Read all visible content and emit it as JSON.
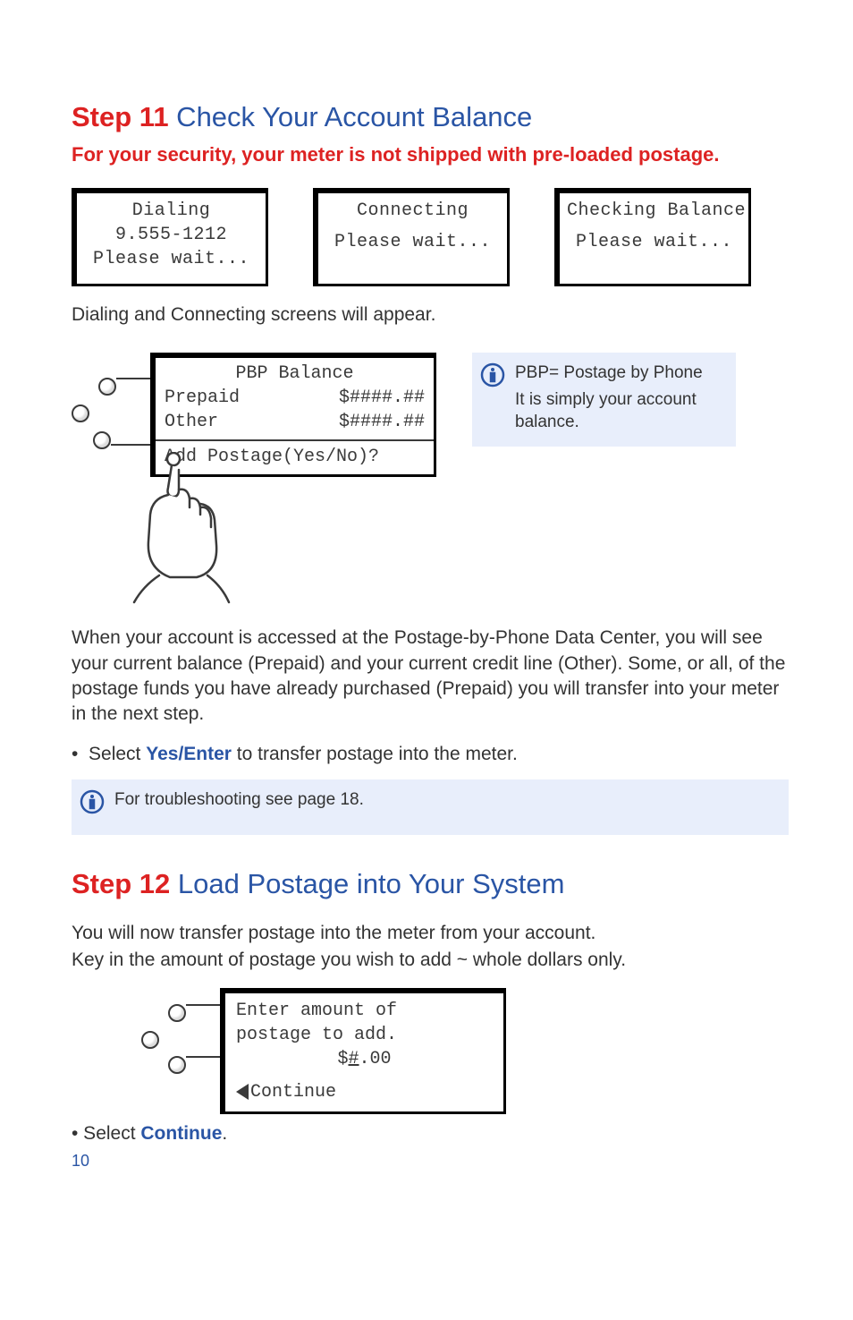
{
  "step11": {
    "num": "Step 11",
    "title": " Check Your Account Balance",
    "warning": "For your security, your meter is not shipped with pre-loaded postage.",
    "lcd1_l1": "Dialing",
    "lcd1_l2": "9.555-1212",
    "lcd1_l3": "Please wait...",
    "lcd2_l1": "Connecting",
    "lcd2_l2": "Please wait...",
    "lcd3_l1": "Checking Balance",
    "lcd3_l2": "Please wait...",
    "caption1": "Dialing and Connecting screens will appear.",
    "balance_title": "PBP Balance",
    "balance_prepaid_label": "Prepaid",
    "balance_prepaid_value": "$####.##",
    "balance_other_label": "Other",
    "balance_other_value": "$####.##",
    "balance_prompt": "Add Postage(Yes/No)?",
    "info1_line1": "PBP= Postage by Phone",
    "info1_line2": "It is simply your account balance.",
    "para1": "When your account is accessed at the Postage-by-Phone Data Center, you will see your current balance (Prepaid) and your current credit line (Other). Some, or all, of the postage funds you have already purchased (Prepaid) you will transfer into your meter in the next step.",
    "bullet1_pre": "Select ",
    "bullet1_kw": "Yes/Enter",
    "bullet1_post": " to transfer postage into the meter.",
    "info2": "For troubleshooting see page 18."
  },
  "step12": {
    "num": "Step 12",
    "title": " Load Postage into Your System",
    "para1": "You will now transfer postage into the meter from your account.",
    "para2": "Key in the amount of postage you wish to add ~ whole dollars only.",
    "lcd_l1": "Enter amount of",
    "lcd_l2": "postage to add.",
    "lcd_amount_prefix": "$",
    "lcd_amount_entry": "#",
    "lcd_amount_suffix": ".00",
    "lcd_continue": "Continue",
    "bullet_pre": "• Select ",
    "bullet_kw": "Continue",
    "bullet_post": "."
  },
  "pagenum": "10"
}
